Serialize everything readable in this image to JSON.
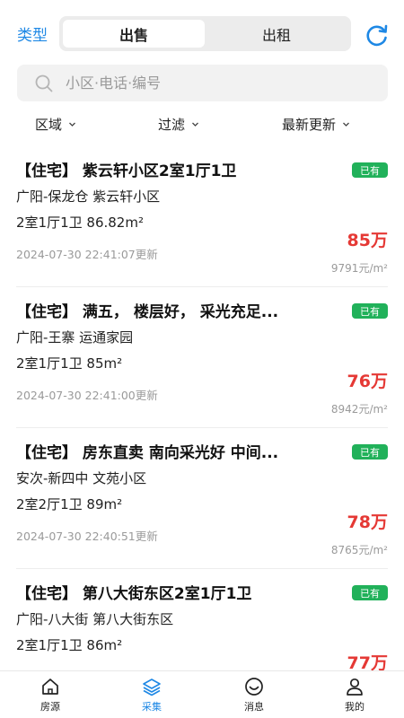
{
  "header": {
    "type_label": "类型",
    "tabs": [
      {
        "label": "出售",
        "active": true
      },
      {
        "label": "出租",
        "active": false
      }
    ],
    "refresh_icon": "refresh-icon",
    "accent_color": "#1e88e5"
  },
  "search": {
    "placeholder": "小区·电话·编号",
    "value": ""
  },
  "filters": [
    {
      "label": "区域"
    },
    {
      "label": "过滤"
    },
    {
      "label": "最新更新"
    }
  ],
  "listings": [
    {
      "title": "【住宅】 紫云轩小区2室1厅1卫",
      "badge": "已有",
      "location": "广阳-保龙仓   紫云轩小区",
      "spec": "2室1厅1卫   86.82m²",
      "updated": "2024-07-30 22:41:07更新",
      "price": "85万",
      "unit_price": "9791元/m²"
    },
    {
      "title": "【住宅】 满五， 楼层好， 采光充足...",
      "badge": "已有",
      "location": "广阳-王寨   运通家园",
      "spec": "2室1厅1卫   85m²",
      "updated": "2024-07-30 22:41:00更新",
      "price": "76万",
      "unit_price": "8942元/m²"
    },
    {
      "title": "【住宅】 房东直卖 南向采光好 中间...",
      "badge": "已有",
      "location": "安次-新四中   文苑小区",
      "spec": "2室2厅1卫   89m²",
      "updated": "2024-07-30 22:40:51更新",
      "price": "78万",
      "unit_price": "8765元/m²"
    },
    {
      "title": "【住宅】 第八大街东区2室1厅1卫",
      "badge": "已有",
      "location": "广阳-八大街   第八大街东区",
      "spec": "2室1厅1卫   86m²",
      "updated": "",
      "price": "77万",
      "unit_price": ""
    }
  ],
  "nav": [
    {
      "label": "房源",
      "icon": "home-icon",
      "active": false
    },
    {
      "label": "采集",
      "icon": "layers-icon",
      "active": true
    },
    {
      "label": "消息",
      "icon": "smiley-icon",
      "active": false
    },
    {
      "label": "我的",
      "icon": "user-icon",
      "active": false
    }
  ],
  "colors": {
    "badge": "#21b15a",
    "price": "#e53935"
  }
}
